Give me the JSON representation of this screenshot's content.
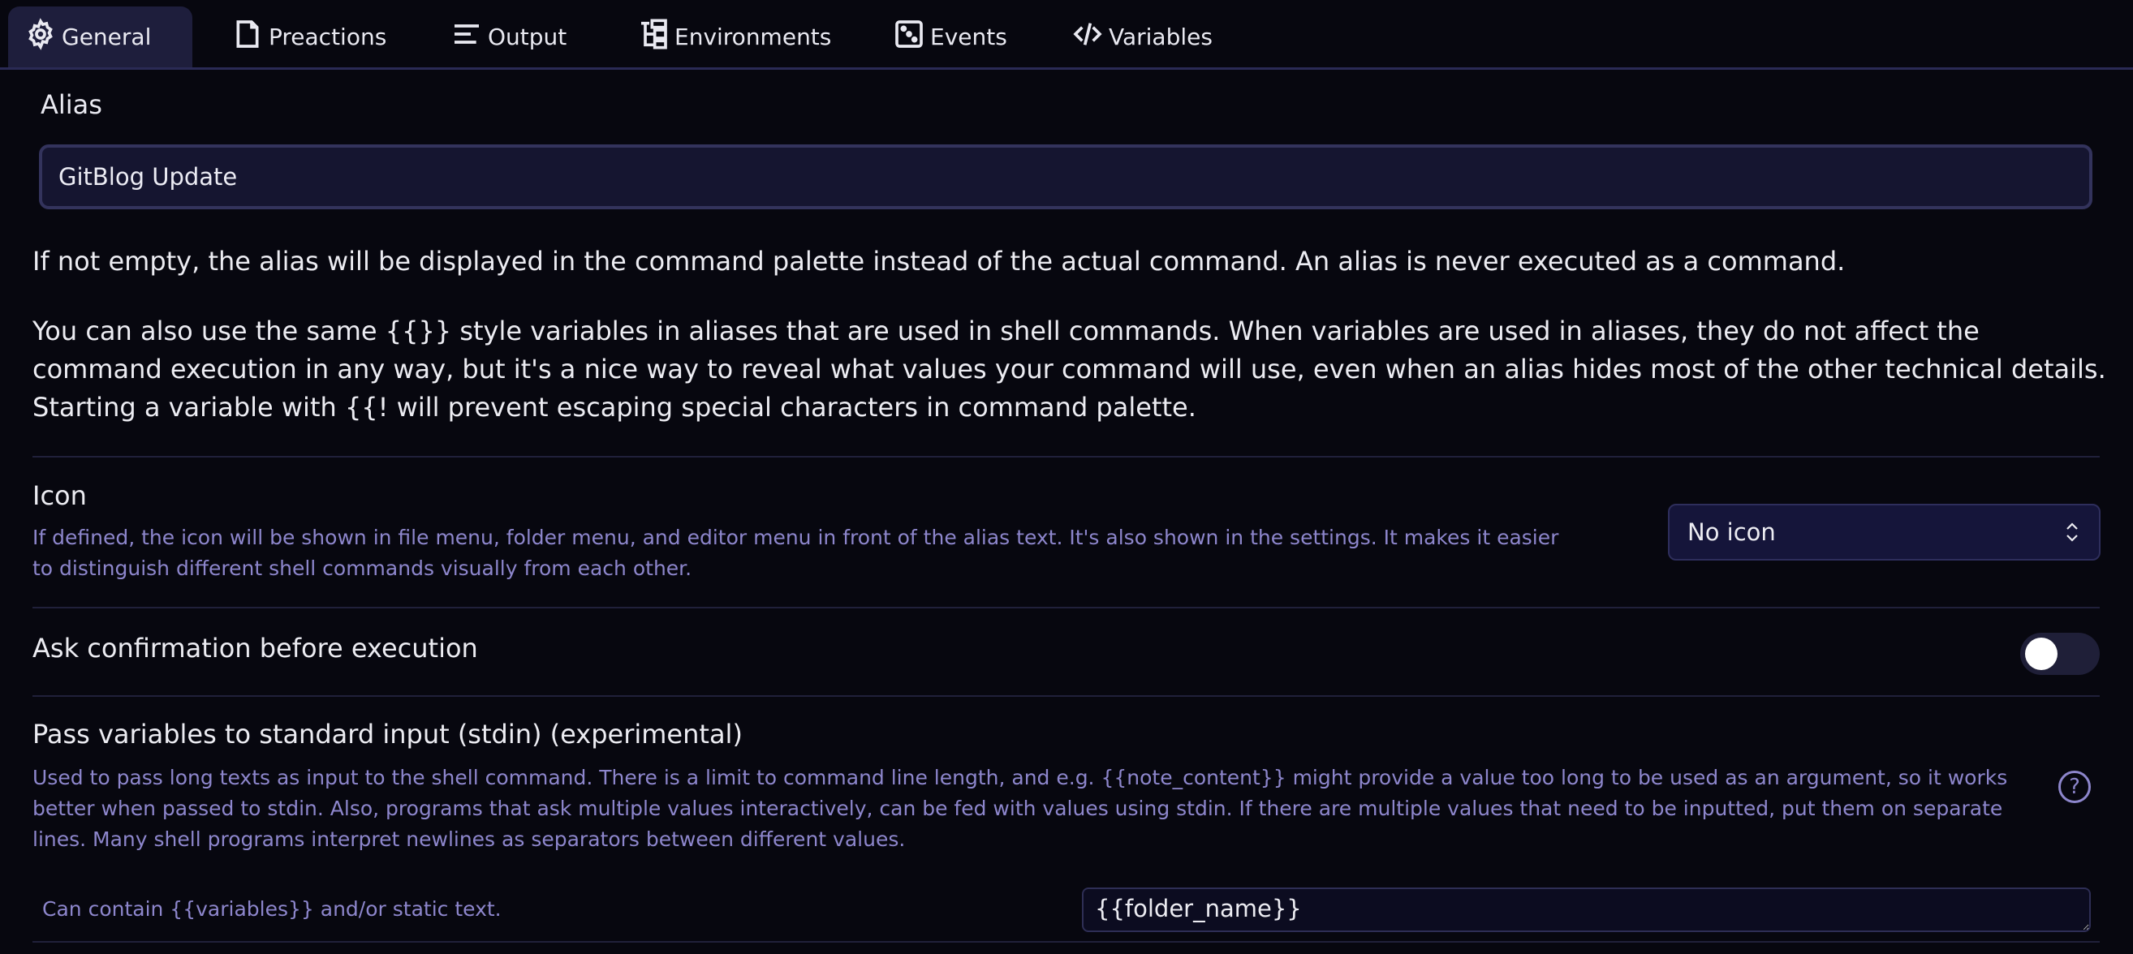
{
  "tabs": [
    {
      "label": "General",
      "icon": "gear-icon",
      "active": true
    },
    {
      "label": "Preactions",
      "icon": "document-icon",
      "active": false
    },
    {
      "label": "Output",
      "icon": "align-left-icon",
      "active": false
    },
    {
      "label": "Environments",
      "icon": "tree-icon",
      "active": false
    },
    {
      "label": "Events",
      "icon": "dice-icon",
      "active": false
    },
    {
      "label": "Variables",
      "icon": "code-icon",
      "active": false
    }
  ],
  "alias": {
    "heading": "Alias",
    "value": "GitBlog Update",
    "desc1": "If not empty, the alias will be displayed in the command palette instead of the actual command. An alias is never executed as a command.",
    "desc2": "You can also use the same {{}} style variables in aliases that are used in shell commands. When variables are used in aliases, they do not affect the command execution in any way, but it's a nice way to reveal what values your command will use, even when an alias hides most of the other technical details. Starting a variable with {{! will prevent escaping special characters in command palette."
  },
  "icon_setting": {
    "title": "Icon",
    "desc": "If defined, the icon will be shown in file menu, folder menu, and editor menu in front of the alias text. It's also shown in the settings. It makes it easier to distinguish different shell commands visually from each other.",
    "selected": "No icon"
  },
  "confirmation": {
    "title": "Ask confirmation before execution",
    "enabled": false
  },
  "stdin": {
    "title": "Pass variables to standard input (stdin) (experimental)",
    "desc": "Used to pass long texts as input to the shell command. There is a limit to command line length, and e.g. {{note_content}} might provide a value too long to be used as an argument, so it works better when passed to stdin. Also, programs that ask multiple values interactively, can be fed with values using stdin. If there are multiple values that need to be inputted, put them on separate lines. Many shell programs interpret newlines as separators between different values.",
    "help": "?",
    "field_label": "Can contain {{variables}} and/or static text.",
    "value": "{{folder_name}}"
  },
  "colors": {
    "background": "#07070f",
    "active_tab": "#1e1e3c",
    "description": "#8d86cc",
    "input_border": "#33335c"
  }
}
